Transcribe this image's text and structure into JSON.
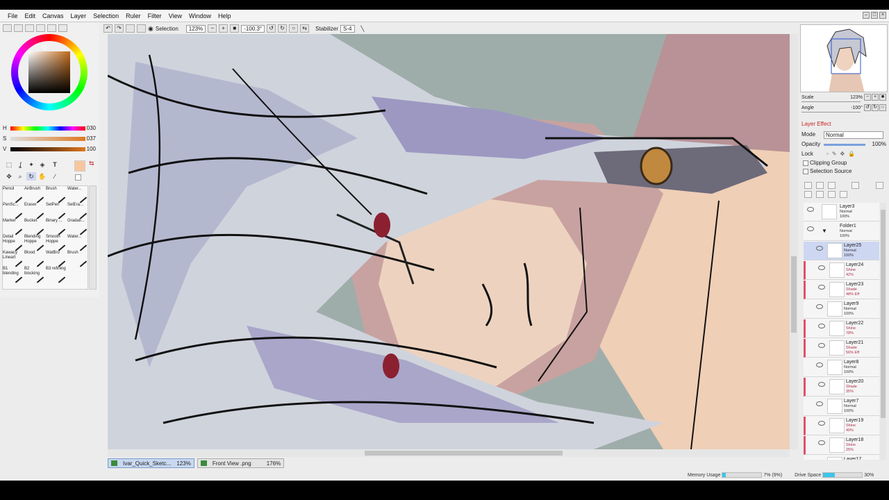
{
  "menu": [
    "File",
    "Edit",
    "Canvas",
    "Layer",
    "Selection",
    "Ruler",
    "Filter",
    "View",
    "Window",
    "Help"
  ],
  "toolbar": {
    "selection_label": "Selection",
    "zoom": "123%",
    "angle": "-100.3°",
    "stabilizer_label": "Stabilizer",
    "stabilizer_value": "S-4"
  },
  "color": {
    "h_label": "H",
    "h_value": "030",
    "s_label": "S",
    "s_value": "037",
    "v_label": "V",
    "v_value": "100",
    "current": "#f8c69d"
  },
  "tools": [
    "selection-rect-icon",
    "lasso-icon",
    "magic-wand-icon",
    "bucket-icon",
    "text-icon",
    "move-icon",
    "zoom-icon",
    "rotate-icon",
    "hand-icon",
    "eyedropper-icon"
  ],
  "brushes": [
    {
      "name": "Pencil",
      "icon": "pencil-brush-icon"
    },
    {
      "name": "AirBrush",
      "icon": "airbrush-icon"
    },
    {
      "name": "Brush",
      "icon": "brush-icon"
    },
    {
      "name": "Water...",
      "icon": "water-brush-icon"
    },
    {
      "name": "PenSc...",
      "icon": "pen-brush-icon"
    },
    {
      "name": "Eraser",
      "icon": "eraser-icon"
    },
    {
      "name": "SelPen",
      "icon": "selpen-icon"
    },
    {
      "name": "SelEra...",
      "icon": "selera-icon"
    },
    {
      "name": "Marker",
      "icon": "marker-icon"
    },
    {
      "name": "Bucket",
      "icon": "bucket-brush-icon"
    },
    {
      "name": "Binary ...",
      "icon": "binary-brush-icon"
    },
    {
      "name": "Gradati...",
      "icon": "gradation-icon"
    },
    {
      "name": "Detail Hoppe",
      "icon": "detail-brush-icon"
    },
    {
      "name": "Blending Hoppe",
      "icon": "blending-brush-icon"
    },
    {
      "name": "Smooth Hoppe",
      "icon": "smooth-brush-icon"
    },
    {
      "name": "Water...",
      "icon": "water-brush-icon"
    },
    {
      "name": "Kawacy Lineart",
      "icon": "lineart-brush-icon"
    },
    {
      "name": "Blood",
      "icon": "blood-brush-icon"
    },
    {
      "name": "WatBru",
      "icon": "watbru-icon"
    },
    {
      "name": "Brush",
      "icon": "brush-icon"
    },
    {
      "name": "B1 blending",
      "icon": "b1-brush-icon"
    },
    {
      "name": "B2 blocking",
      "icon": "b2-brush-icon"
    },
    {
      "name": "B3 refining",
      "icon": "b3-brush-icon"
    }
  ],
  "tabs": [
    {
      "name": "Ivar_Quick_Sketc...",
      "zoom": "123%"
    },
    {
      "name": "Front View .png",
      "zoom": "176%"
    }
  ],
  "status": {
    "memory_label": "Memory Usage",
    "memory_value": "7% (9%)",
    "memory_fraction": 0.09,
    "drive_label": "Drive Space",
    "drive_value": "30%",
    "drive_fraction": 0.3
  },
  "navigator": {
    "scale_label": "Scale",
    "scale_value": "123%",
    "angle_label": "Angle",
    "angle_value": "-100°"
  },
  "layer_effect": {
    "header": "Layer Effect",
    "mode_label": "Mode",
    "mode_value": "Normal",
    "opacity_label": "Opacity",
    "opacity_value": "100%",
    "lock_label": "Lock",
    "clipping_label": "Clipping Group",
    "selection_source_label": "Selection Source"
  },
  "layers": [
    {
      "name": "Layer3",
      "mode": "Normal",
      "opacity": "100%"
    },
    {
      "name": "Folder1",
      "mode": "Normal",
      "opacity": "100%"
    },
    {
      "name": "Layer25",
      "mode": "Normal",
      "opacity": "100%"
    },
    {
      "name": "Layer24",
      "mode": "Shine",
      "opacity": "42%"
    },
    {
      "name": "Layer23",
      "mode": "Shade",
      "opacity": "48% Eff"
    },
    {
      "name": "Layer9",
      "mode": "Normal",
      "opacity": "100%"
    },
    {
      "name": "Layer22",
      "mode": "Shine",
      "opacity": "78%"
    },
    {
      "name": "Layer21",
      "mode": "Shade",
      "opacity": "56% Eff"
    },
    {
      "name": "Layer8",
      "mode": "Normal",
      "opacity": "100%"
    },
    {
      "name": "Layer20",
      "mode": "Shade",
      "opacity": "35%"
    },
    {
      "name": "Layer7",
      "mode": "Normal",
      "opacity": "100%"
    },
    {
      "name": "Layer19",
      "mode": "Shine",
      "opacity": "40%"
    },
    {
      "name": "Layer18",
      "mode": "Shine",
      "opacity": "25%"
    },
    {
      "name": "Layer17",
      "mode": "",
      "opacity": ""
    }
  ]
}
